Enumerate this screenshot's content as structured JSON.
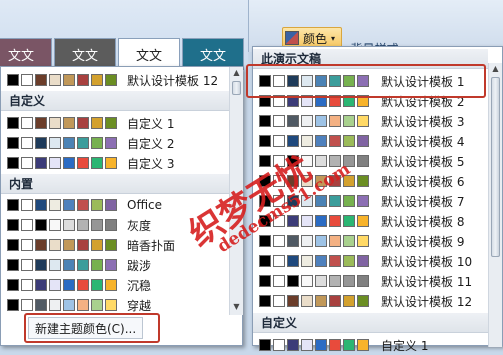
{
  "ribbon": {
    "theme_thumbs": [
      "文文",
      "文文",
      "文文",
      "文文"
    ],
    "color_button": "颜色",
    "bg_style": "背景样式"
  },
  "left": {
    "top_item": "默认设计模板 12",
    "custom_header": "自定义",
    "custom_items": [
      "自定义 1",
      "自定义 2",
      "自定义 3"
    ],
    "builtin_header": "内置",
    "builtin_items": [
      "Office",
      "灰度",
      "暗香扑面",
      "跋涉",
      "沉稳",
      "穿越"
    ],
    "new_color_label": "新建主题颜色(C)..."
  },
  "right": {
    "header": "此演示文稿",
    "items": [
      "默认设计模板 1",
      "默认设计模板 2",
      "默认设计模板 3",
      "默认设计模板 4",
      "默认设计模板 5",
      "默认设计模板 6",
      "默认设计模板 7",
      "默认设计模板 8",
      "默认设计模板 9",
      "默认设计模板 10",
      "默认设计模板 11",
      "默认设计模板 12"
    ],
    "custom_header": "自定义",
    "custom_items": [
      "自定义 1"
    ]
  },
  "watermark": {
    "line1": "织梦无忧",
    "line2": "dedecms51.com"
  },
  "palettes": {
    "office": [
      "#000000",
      "#ffffff",
      "#1f497d",
      "#eeece1",
      "#4f81bd",
      "#c0504d",
      "#9bbb59",
      "#8064a2"
    ],
    "gray": [
      "#000000",
      "#ffffff",
      "#000000",
      "#f8f8f8",
      "#dddddd",
      "#b2b2b2",
      "#969696",
      "#808080"
    ],
    "warm": [
      "#000000",
      "#ffffff",
      "#6b3d2a",
      "#eaddc9",
      "#c19859",
      "#a8413f",
      "#d3a12e",
      "#6b8e23"
    ],
    "cool": [
      "#000000",
      "#ffffff",
      "#1f3b5a",
      "#dde8f0",
      "#4c83b5",
      "#3b9d9b",
      "#77b14f",
      "#8c6fb3"
    ],
    "vivid": [
      "#000000",
      "#ffffff",
      "#3c3c78",
      "#e4e4f7",
      "#2b6cc4",
      "#e84b3c",
      "#2bb673",
      "#f7b32b"
    ],
    "pastel": [
      "#000000",
      "#ffffff",
      "#505a64",
      "#eef0f2",
      "#9ec3e6",
      "#f4b183",
      "#a9d18e",
      "#ffd966"
    ]
  }
}
